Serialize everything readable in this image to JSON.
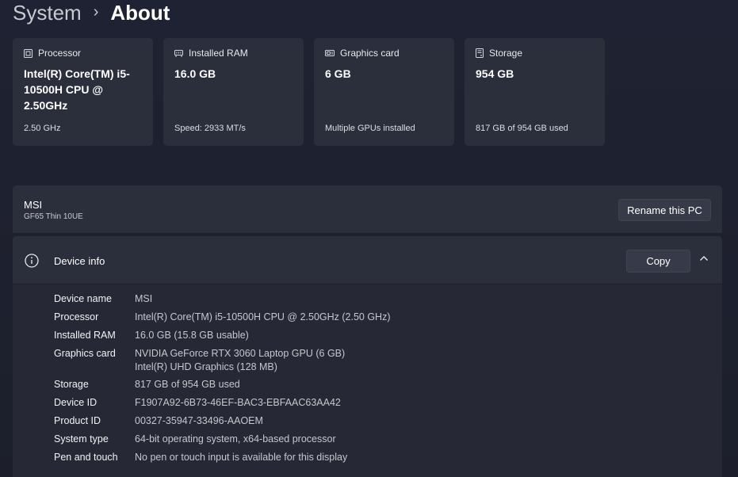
{
  "breadcrumb": {
    "parent": "System",
    "separator": "›",
    "current": "About"
  },
  "spec_cards": [
    {
      "icon": "processor-icon",
      "label": "Processor",
      "value": "Intel(R) Core(TM) i5-10500H CPU @ 2.50GHz",
      "sub": "2.50 GHz"
    },
    {
      "icon": "ram-icon",
      "label": "Installed RAM",
      "value": "16.0 GB",
      "sub": "Speed: 2933 MT/s"
    },
    {
      "icon": "graphics-card-icon",
      "label": "Graphics card",
      "value": "6 GB",
      "sub": "Multiple GPUs installed"
    },
    {
      "icon": "storage-icon",
      "label": "Storage",
      "value": "954 GB",
      "sub": "817 GB of 954 GB used"
    }
  ],
  "pc": {
    "name": "MSI",
    "model": "GF65 Thin 10UE",
    "rename_label": "Rename this PC"
  },
  "device_info": {
    "icon": "info-icon",
    "title": "Device info",
    "copy_label": "Copy",
    "rows": [
      {
        "label": "Device name",
        "value": "MSI"
      },
      {
        "label": "Processor",
        "value": "Intel(R) Core(TM) i5-10500H CPU @ 2.50GHz (2.50 GHz)"
      },
      {
        "label": "Installed RAM",
        "value": "16.0 GB (15.8 GB usable)"
      },
      {
        "label": "Graphics card",
        "value": "NVIDIA GeForce RTX 3060 Laptop GPU (6 GB)",
        "value2": "Intel(R) UHD Graphics (128 MB)"
      },
      {
        "label": "Storage",
        "value": "817 GB of 954 GB used"
      },
      {
        "label": "Device ID",
        "value": "F1907A92-6B73-46EF-BAC3-EBFAAC63AA42"
      },
      {
        "label": "Product ID",
        "value": "00327-35947-33496-AAOEM"
      },
      {
        "label": "System type",
        "value": "64-bit operating system, x64-based processor"
      },
      {
        "label": "Pen and touch",
        "value": "No pen or touch input is available for this display"
      }
    ]
  },
  "colors": {
    "background": "#1e2130",
    "card": "#2b2e3b",
    "button": "#373a48",
    "text_secondary": "#c6c7ce"
  }
}
